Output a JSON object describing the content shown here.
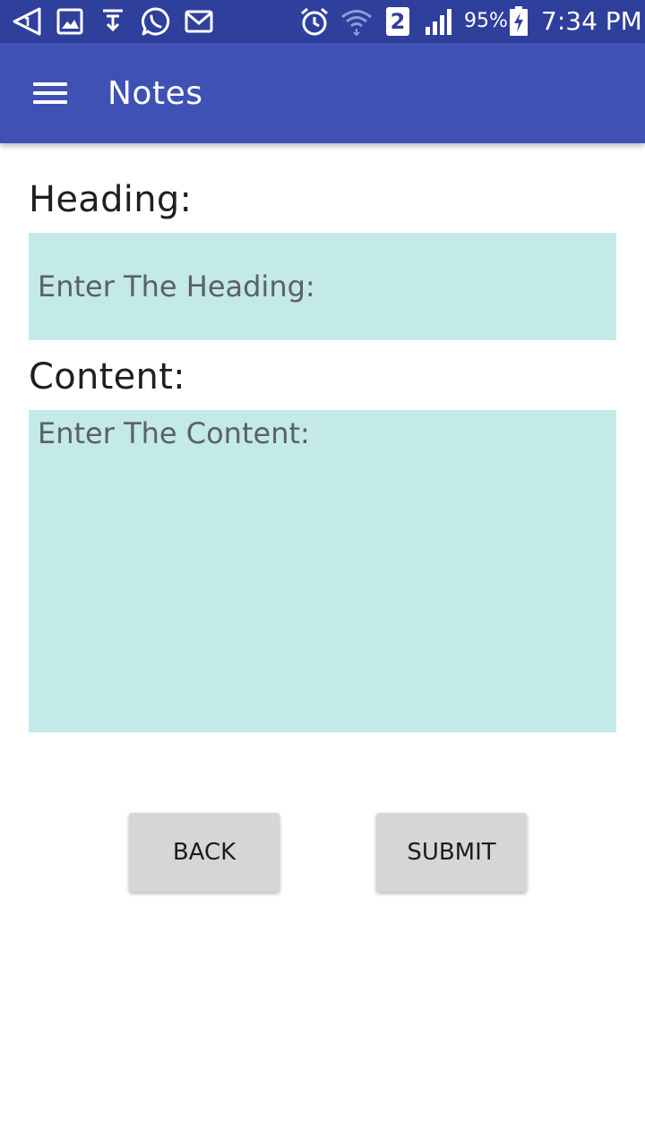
{
  "status_bar": {
    "battery_percent": "95%",
    "time": "7:34 PM",
    "sim_badge": "2",
    "background_color": "#2f3f9c",
    "icons_left": [
      "navigation-arrow-icon",
      "image-icon",
      "download-icon",
      "whatsapp-icon",
      "mail-icon"
    ],
    "icons_right": [
      "alarm-icon",
      "wifi-icon",
      "sim-2-badge",
      "signal-icon",
      "battery-charging-icon"
    ]
  },
  "app_bar": {
    "title": "Notes",
    "background_color": "#3f51b5",
    "menu_icon": "hamburger-menu-icon"
  },
  "form": {
    "heading_label": "Heading:",
    "heading_value": "",
    "heading_placeholder": "Enter The Heading:",
    "content_label": "Content:",
    "content_value": "",
    "content_placeholder": "Enter The Content:",
    "field_background": "#c3e9e8"
  },
  "buttons": {
    "back_label": "Back",
    "submit_label": "Submit",
    "background_color": "#d6d6d6"
  }
}
